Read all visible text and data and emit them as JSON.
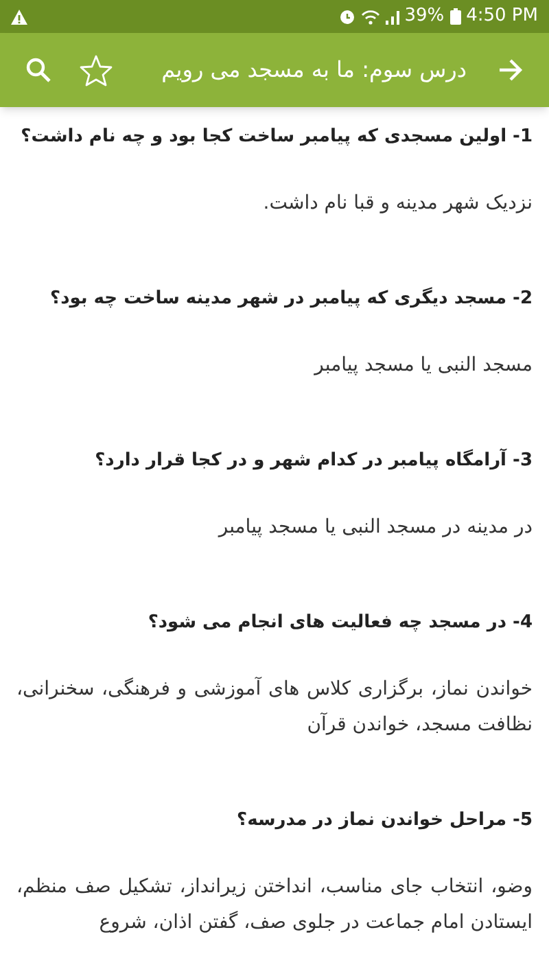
{
  "status_bar": {
    "battery": "39%",
    "time": "4:50 PM"
  },
  "toolbar": {
    "title": "درس سوم: ما به مسجد می رویم",
    "favorite": false
  },
  "items": [
    {
      "question": "1- اولین مسجدی که پیامبر ساخت کجا بود و چه نام داشت؟",
      "answer": "نزدیک شهر مدینه و قبا نام داشت."
    },
    {
      "question": "2- مسجد دیگری که پیامبر در شهر مدینه ساخت چه بود؟",
      "answer": "مسجد النبی یا مسجد پیامبر"
    },
    {
      "question": "3- آرامگاه پیامبر در کدام شهر و در کجا قرار دارد؟",
      "answer": "در مدینه در مسجد النبی یا مسجد پیامبر"
    },
    {
      "question": "4- در مسجد چه فعالیت های انجام می شود؟",
      "answer": "خواندن نماز، برگزاری کلاس های آموزشی و فرهنگی، سخنرانی، نظافت مسجد، خواندن قرآن"
    },
    {
      "question": "5- مراحل خواندن نماز در مدرسه؟",
      "answer": "وضو، انتخاب جای مناسب، انداختن زیرانداز، تشکیل صف منظم، ایستادن امام جماعت در جلوی صف، گفتن اذان، شروع"
    }
  ]
}
